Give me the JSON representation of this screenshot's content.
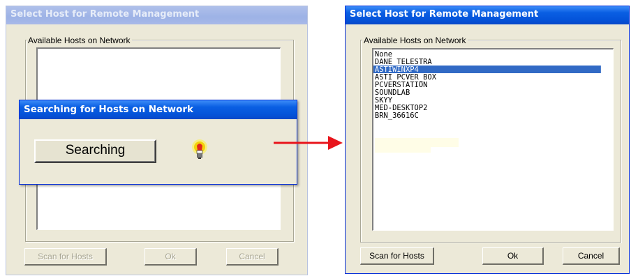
{
  "left_window": {
    "title": "Select Host for Remote Management",
    "group_label": "Available Hosts on Network",
    "buttons": {
      "scan": "Scan for Hosts",
      "ok": "Ok",
      "cancel": "Cancel"
    }
  },
  "search_dialog": {
    "title": "Searching for Hosts on Network",
    "status": "Searching",
    "icon": "lightbulb-icon"
  },
  "arrow": {
    "color": "#E8141B",
    "icon": "right-arrow-icon"
  },
  "right_window": {
    "title": "Select Host for Remote Management",
    "group_label": "Available Hosts on Network",
    "hosts": [
      "None",
      "DANE_TELESTRA",
      "ASTIWINXP4",
      "ASTI_PCVER_BOX",
      "PCVERSTATION",
      "SOUNDLAB",
      "SKYY",
      "MED-DESKTOP2",
      "BRN_36616C"
    ],
    "selected_index": 2,
    "buttons": {
      "scan": "Scan for Hosts",
      "ok": "Ok",
      "cancel": "Cancel"
    }
  },
  "colors": {
    "selection": "#316AC5",
    "dialog_face": "#ECE9D8",
    "active_title": "#0A5FE3"
  }
}
